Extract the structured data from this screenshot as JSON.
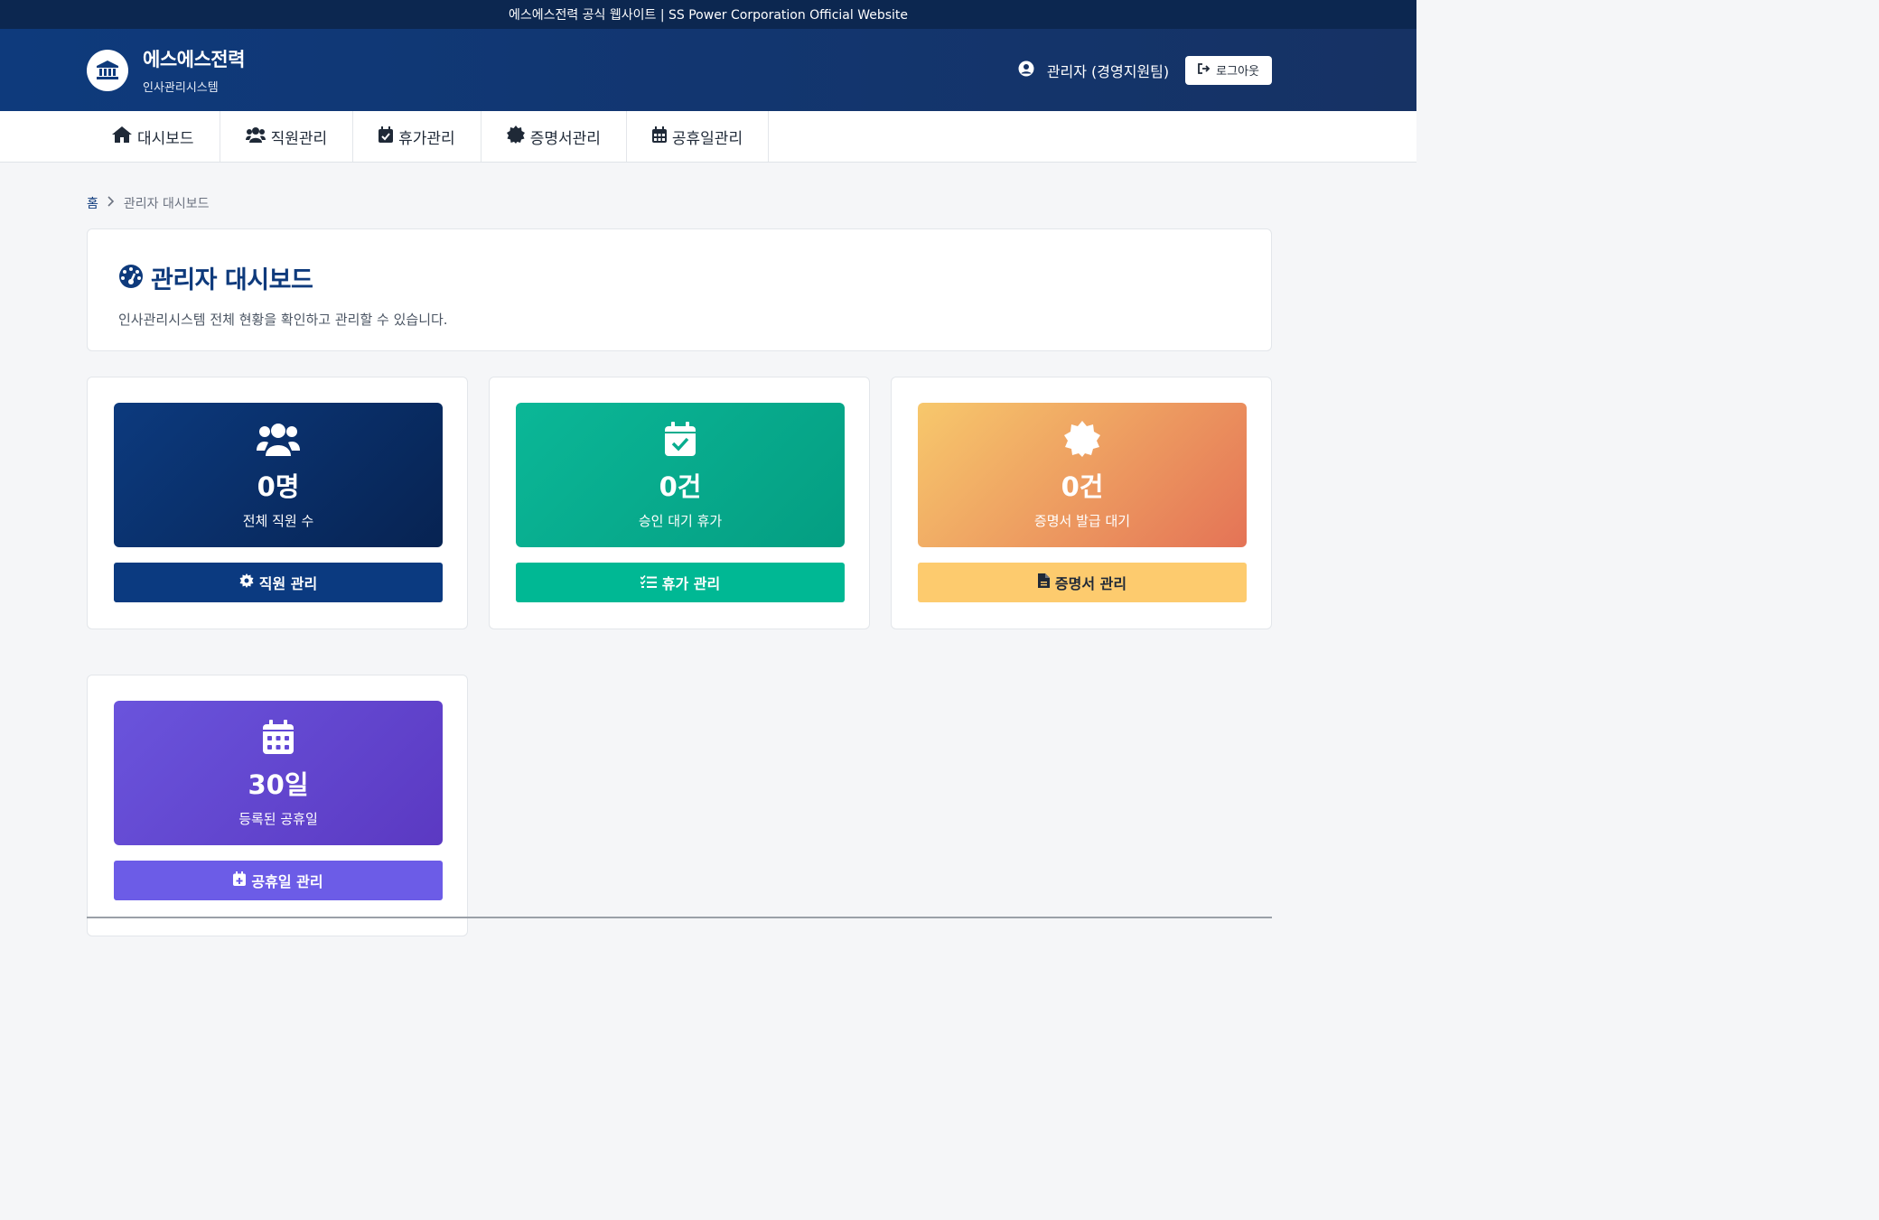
{
  "top_strip": {
    "text": "에스에스전력 공식 웹사이트 | SS Power Corporation Official Website"
  },
  "header": {
    "brand_name": "에스에스전력",
    "brand_sub": "인사관리시스템",
    "user_label": "관리자 (경영지원팀)",
    "logout_label": "로그아웃"
  },
  "nav": {
    "items": [
      {
        "label": "대시보드",
        "icon": "home-icon"
      },
      {
        "label": "직원관리",
        "icon": "users-icon"
      },
      {
        "label": "휴가관리",
        "icon": "calendar-check-icon"
      },
      {
        "label": "증명서관리",
        "icon": "certificate-icon"
      },
      {
        "label": "공휴일관리",
        "icon": "calendar-icon"
      }
    ]
  },
  "breadcrumb": {
    "home": "홈",
    "current": "관리자 대시보드"
  },
  "main": {
    "title": "관리자 대시보드",
    "description": "인사관리시스템 전체 현황을 확인하고 관리할 수 있습니다."
  },
  "stats": [
    {
      "value": "0명",
      "label": "전체 직원 수",
      "button": "직원 관리",
      "icon": "users-icon",
      "button_icon": "gear-icon",
      "color": "#0b3a80"
    },
    {
      "value": "0건",
      "label": "승인 대기 휴가",
      "button": "휴가 관리",
      "icon": "calendar-check-icon",
      "button_icon": "list-check-icon",
      "color": "#00b894"
    },
    {
      "value": "0건",
      "label": "증명서 발급 대기",
      "button": "증명서 관리",
      "icon": "certificate-icon",
      "button_icon": "file-icon",
      "color": "#fdcb6e"
    },
    {
      "value": "30일",
      "label": "등록된 공휴일",
      "button": "공휴일 관리",
      "icon": "calendar-days-icon",
      "button_icon": "calendar-plus-icon",
      "color": "#6c5ce7"
    }
  ]
}
